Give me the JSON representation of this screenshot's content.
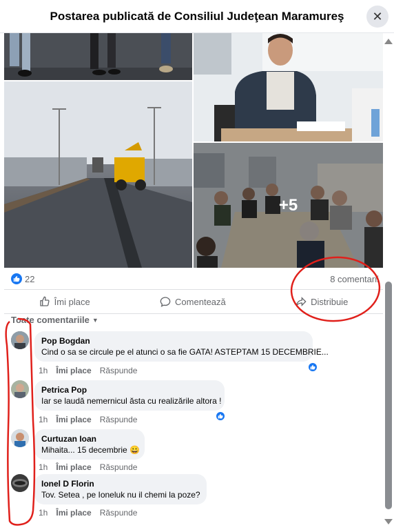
{
  "header": {
    "title": "Postarea publicată de Consiliul Judeţean Maramureş",
    "close_label": "✕"
  },
  "photos": {
    "more_count": "+5"
  },
  "stats": {
    "likes": "22",
    "comments": "8 comentarii"
  },
  "actions": {
    "like": "Îmi place",
    "comment": "Comentează",
    "share": "Distribuie"
  },
  "filter": {
    "label": "Toate comentariile"
  },
  "comments": [
    {
      "author": "Pop Bogdan",
      "text": "Cind o sa se circule pe el atunci o sa fie GATA! ASTEPTAM 15 DECEMBRIE...",
      "time": "1h",
      "like": "Îmi place",
      "reply": "Răspunde"
    },
    {
      "author": "Petrica Pop",
      "text": "Iar se laudă nemernicul ăsta cu realizările altora !",
      "time": "1h",
      "like": "Îmi place",
      "reply": "Răspunde"
    },
    {
      "author": "Curtuzan Ioan",
      "text": "Mihaita... 15 decembrie 😀",
      "time": "1h",
      "like": "Îmi place",
      "reply": "Răspunde"
    },
    {
      "author": "Ionel D Florin",
      "text": "Tov. Setea , pe Ioneluk nu il chemi la poze?",
      "time": "1h",
      "like": "Îmi place",
      "reply": "Răspunde"
    }
  ],
  "colors": {
    "facebook_blue": "#1877f2",
    "annotation_red": "#e0201b",
    "bubble_bg": "#f0f2f5"
  }
}
